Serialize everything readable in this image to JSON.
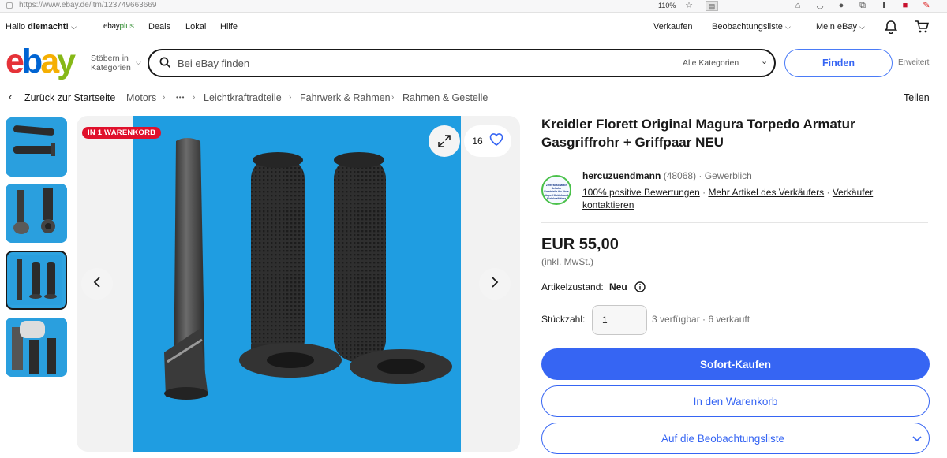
{
  "browser": {
    "url": "https://www.ebay.de/itm/123749663669",
    "zoom": "110%"
  },
  "topnav": {
    "greeting_prefix": "Hallo",
    "greeting_user": "diemacht!",
    "ebayplus_a": "ebay",
    "ebayplus_b": "plus",
    "deals": "Deals",
    "lokal": "Lokal",
    "hilfe": "Hilfe",
    "verkaufen": "Verkaufen",
    "beobachtungsliste": "Beobachtungsliste",
    "mein_ebay": "Mein eBay"
  },
  "header": {
    "logo_letters": [
      "e",
      "b",
      "a",
      "y"
    ],
    "logo_colors": [
      "#e53238",
      "#0064d2",
      "#f5af02",
      "#86b817"
    ],
    "stoebern_line1": "Stöbern in",
    "stoebern_line2": "Kategorien",
    "search_placeholder": "Bei eBay finden",
    "category": "Alle Kategorien",
    "find_button": "Finden",
    "erweitert": "Erweitert"
  },
  "breadcrumb": {
    "back": "Zurück zur Startseite",
    "items": [
      "Motors",
      "Leichtkraftradteile",
      "Fahrwerk & Rahmen",
      "Rahmen & Gestelle"
    ],
    "ellipsis": "•••",
    "share": "Teilen"
  },
  "gallery": {
    "badge": "IN 1 WARENKORB",
    "watch_count": "16",
    "thumbnail_count": 4,
    "selected_thumbnail": 3
  },
  "item": {
    "title": "Kreidler Florett Original Magura Torpedo Armatur Gasgriffrohr + Griffpaar NEU",
    "seller_name": "hercuzuendmann",
    "seller_score": "(48068)",
    "seller_type": "Gewerblich",
    "seller_logo_text": [
      "Zweiradschätzle",
      "Schuler",
      "Ersatzteile für Mofa",
      "Moped Mokick und",
      "Kleinkrafträder"
    ],
    "feedback_link": "100% positive Bewertungen",
    "more_items_link": "Mehr Artikel des Verkäufers",
    "contact_link_a": "Verkäufer",
    "contact_link_b": "kontaktieren",
    "price": "EUR 55,00",
    "tax_note": "(inkl. MwSt.)",
    "condition_label": "Artikelzustand:",
    "condition_value": "Neu",
    "qty_label": "Stückzahl:",
    "qty_value": "1",
    "availability": "3 verfügbar · 6 verkauft"
  },
  "buttons": {
    "buy_now": "Sofort-Kaufen",
    "add_to_cart": "In den Warenkorb",
    "watchlist": "Auf die Beobachtungsliste"
  },
  "colors": {
    "accent": "#3665f3",
    "badge": "#e0102b",
    "photo_bg": "#1f9de1"
  }
}
